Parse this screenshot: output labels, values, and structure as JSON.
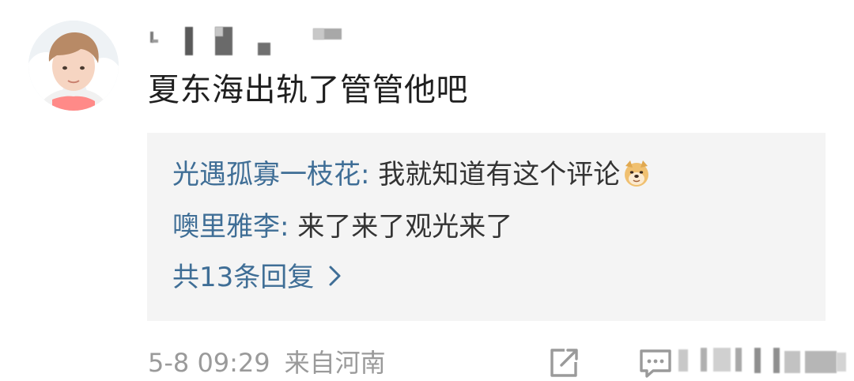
{
  "comment": {
    "username": "",
    "text": "夏东海出轨了管管他吧",
    "replies": [
      {
        "user": "光遇孤寡一枝花",
        "separator": ": ",
        "content": "我就知道有这个评论",
        "emoji": "doge-emoji"
      },
      {
        "user": "噢里雅李",
        "separator": ": ",
        "content": "来了来了观光来了"
      }
    ],
    "more_replies": "共13条回复",
    "time": "5-8 09:29",
    "location": "来自河南"
  },
  "icons": {
    "share": "share-icon",
    "comment": "comment-icon",
    "more": "chevron-right-icon"
  },
  "colors": {
    "link": "#3f6e96",
    "text": "#1f1f1f",
    "meta": "#9a9a9a",
    "reply_bg": "#f4f4f4"
  }
}
